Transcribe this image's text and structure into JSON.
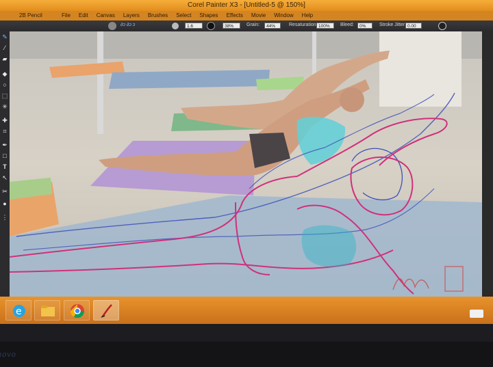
{
  "window": {
    "title": "Corel Painter X3 - [Untitled-5 @ 150%]"
  },
  "menubar": {
    "tool_name": "2B Pencil",
    "items": [
      "File",
      "Edit",
      "Canvas",
      "Layers",
      "Brushes",
      "Select",
      "Shapes",
      "Effects",
      "Movie",
      "Window",
      "Help"
    ]
  },
  "propbar": {
    "size_value": "1.6",
    "opacity_value": "38%",
    "grain_label": "Grain:",
    "grain_value": "44%",
    "resaturation_label": "Resaturation:",
    "resaturation_value": "100%",
    "bleed_label": "Bleed:",
    "bleed_value": "0%",
    "stroke_jitter_label": "Stroke Jitter:",
    "stroke_jitter_value": "0.00"
  },
  "toolbox": {
    "tools": [
      "brush-tool",
      "dropper-tool",
      "eraser-tool",
      "paint-bucket-tool",
      "lasso-tool",
      "rectangle-select-tool",
      "magic-wand-tool",
      "transform-tool",
      "crop-tool",
      "move-tool",
      "pen-tool",
      "rectangle-shape-tool",
      "text-tool",
      "shape-select-tool",
      "divine-proportion-tool",
      "mirror-tool",
      "grabber-tool",
      "magnifier-tool"
    ]
  },
  "taskbar": {
    "apps": [
      {
        "name": "internet-explorer-icon",
        "active": false
      },
      {
        "name": "file-explorer-icon",
        "active": false
      },
      {
        "name": "chrome-icon",
        "active": false
      },
      {
        "name": "corel-painter-icon",
        "active": true
      }
    ]
  },
  "bezel": {
    "brand": "novo"
  },
  "colors": {
    "taskbar": "#d8801f",
    "titlebar": "#f0a030",
    "stroke_magenta": "#d0307a",
    "stroke_blue": "#3d4fb8",
    "stroke_cyan": "#2fb6c8"
  }
}
